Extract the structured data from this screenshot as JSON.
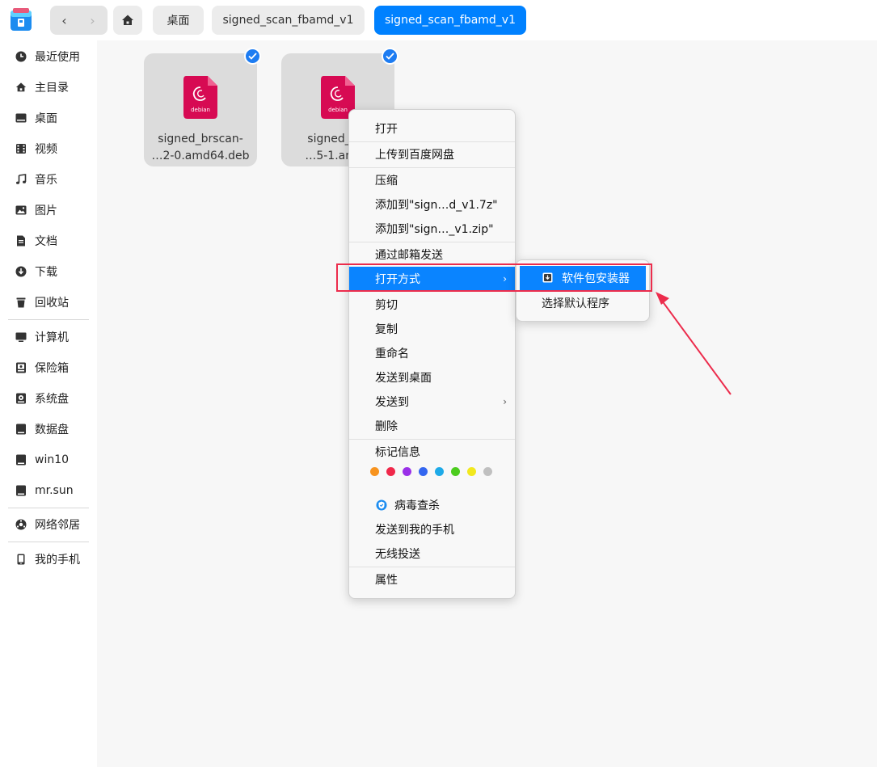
{
  "topbar": {
    "back_glyph": "‹",
    "forward_glyph": "›",
    "breadcrumbs": [
      {
        "label": "桌面"
      },
      {
        "label": "signed_scan_fbamd_v1"
      },
      {
        "label": "signed_scan_fbamd_v1"
      }
    ]
  },
  "sidebar": {
    "items": [
      {
        "label": "最近使用",
        "icon": "clock-icon"
      },
      {
        "label": "主目录",
        "icon": "home-icon"
      },
      {
        "label": "桌面",
        "icon": "desktop-icon"
      },
      {
        "label": "视频",
        "icon": "video-icon"
      },
      {
        "label": "音乐",
        "icon": "music-icon"
      },
      {
        "label": "图片",
        "icon": "picture-icon"
      },
      {
        "label": "文档",
        "icon": "document-icon"
      },
      {
        "label": "下载",
        "icon": "download-icon"
      },
      {
        "label": "回收站",
        "icon": "trash-icon"
      },
      {
        "label": "计算机",
        "icon": "computer-icon"
      },
      {
        "label": "保险箱",
        "icon": "vault-icon"
      },
      {
        "label": "系统盘",
        "icon": "system-disk-icon"
      },
      {
        "label": "数据盘",
        "icon": "disk-icon"
      },
      {
        "label": "win10",
        "icon": "disk-icon"
      },
      {
        "label": "mr.sun",
        "icon": "disk-icon"
      },
      {
        "label": "网络邻居",
        "icon": "network-icon"
      },
      {
        "label": "我的手机",
        "icon": "phone-icon"
      }
    ]
  },
  "files": [
    {
      "line1": "signed_brscan-",
      "line2": "…2-0.amd64.deb",
      "icon_text": "debian",
      "selected": true
    },
    {
      "line1": "signed_brs",
      "line2": "…5-1.amd6",
      "icon_text": "debian",
      "selected": true
    }
  ],
  "context_menu": {
    "items": [
      "打开",
      "上传到百度网盘",
      "压缩",
      "添加到\"sign…d_v1.7z\"",
      "添加到\"sign…_v1.zip\"",
      "通过邮箱发送",
      "打开方式",
      "剪切",
      "复制",
      "重命名",
      "发送到桌面",
      "发送到",
      "删除",
      "标记信息",
      "病毒查杀",
      "发送到我的手机",
      "无线投送",
      "属性"
    ],
    "highlighted": "打开方式",
    "tag_colors": [
      "#f7931e",
      "#f0284a",
      "#9a30e8",
      "#3366f0",
      "#1eaae8",
      "#4ccc1e",
      "#f2e81e",
      "#c0c0c0"
    ]
  },
  "submenu": {
    "items": [
      "软件包安装器",
      "选择默认程序"
    ],
    "highlighted": "软件包安装器"
  },
  "colors": {
    "accent": "#0a84ff",
    "annotation": "#ec2c4c",
    "debian": "#d70a53"
  }
}
